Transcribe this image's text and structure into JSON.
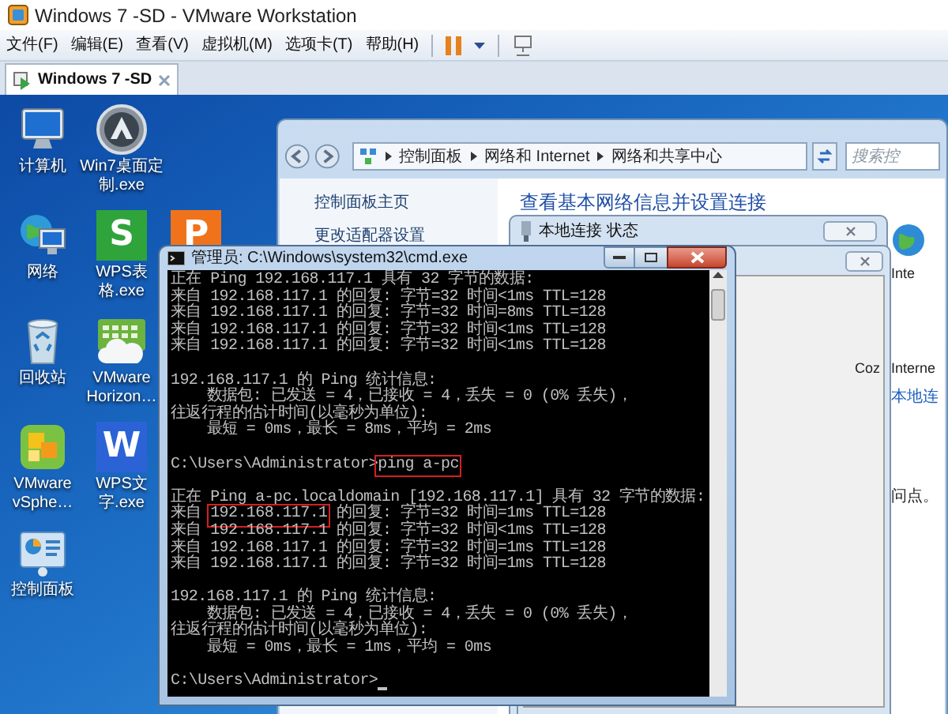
{
  "window": {
    "title": "Windows 7 -SD - VMware Workstation"
  },
  "menu": [
    "文件(F)",
    "编辑(E)",
    "查看(V)",
    "虚拟机(M)",
    "选项卡(T)",
    "帮助(H)"
  ],
  "tabs": [
    {
      "label": "Windows 7 -SD",
      "selected": true
    }
  ],
  "desktop_icons": [
    {
      "kind": "computer",
      "label": "计算机"
    },
    {
      "kind": "network",
      "label": "网络"
    },
    {
      "kind": "recycle-bin",
      "label": "回收站"
    },
    {
      "kind": "vsphere",
      "label": "VMware vSphe…"
    },
    {
      "kind": "control-panel",
      "label": "控制面板"
    },
    {
      "kind": "customizer",
      "label": "Win7桌面定制.exe"
    },
    {
      "kind": "spreadsheet",
      "label": "WPS表格.exe",
      "glyph": "S"
    },
    {
      "kind": "horizon",
      "label": "VMware Horizon…"
    },
    {
      "kind": "writer",
      "label": "WPS文字.exe",
      "glyph": "W"
    }
  ],
  "partial_icon": {
    "kind": "presentation",
    "glyph": "P"
  },
  "explorer": {
    "breadcrumb": [
      "控制面板",
      "网络和 Internet",
      "网络和共享中心"
    ],
    "search": {
      "placeholder": "搜索控"
    },
    "sidebar": [
      "控制面板主页",
      "更改适配器设置"
    ],
    "heading": "查看基本网络信息并设置连接",
    "right_texts": [
      {
        "kind": "label",
        "text": "Inte"
      },
      {
        "kind": "label",
        "text": "Interne"
      },
      {
        "kind": "link",
        "text": "本地连"
      },
      {
        "kind": "label",
        "text": "问点。"
      }
    ]
  },
  "dialogs": [
    {
      "title": "本地连接 状态"
    },
    {
      "text": "Coz"
    }
  ],
  "cmd": {
    "title": "管理员: C:\\Windows\\system32\\cmd.exe",
    "lines": [
      {
        "kind": "text",
        "text": "正在 Ping 192.168.117.1 具有 32 字节的数据:"
      },
      {
        "kind": "text",
        "text": "来自 192.168.117.1 的回复: 字节=32 时间<1ms TTL=128"
      },
      {
        "kind": "text",
        "text": "来自 192.168.117.1 的回复: 字节=32 时间=8ms TTL=128"
      },
      {
        "kind": "text",
        "text": "来自 192.168.117.1 的回复: 字节=32 时间<1ms TTL=128"
      },
      {
        "kind": "text",
        "text": "来自 192.168.117.1 的回复: 字节=32 时间<1ms TTL=128"
      },
      {
        "kind": "blank"
      },
      {
        "kind": "text",
        "text": "192.168.117.1 的 Ping 统计信息:"
      },
      {
        "kind": "text",
        "text": "    数据包: 已发送 = 4，已接收 = 4，丢失 = 0 (0% 丢失)，"
      },
      {
        "kind": "text",
        "text": "往返行程的估计时间(以毫秒为单位):"
      },
      {
        "kind": "text",
        "text": "    最短 = 0ms，最长 = 8ms，平均 = 2ms"
      },
      {
        "kind": "blank"
      },
      {
        "kind": "marked",
        "before": "C:\\Users\\Administrator>",
        "marked": "ping a-pc"
      },
      {
        "kind": "blank"
      },
      {
        "kind": "text",
        "text": "正在 Ping a-pc.localdomain [192.168.117.1] 具有 32 字节的数据:"
      },
      {
        "kind": "marked",
        "before": "来自 ",
        "marked": "192.168.117.1",
        "after": " 的回复: 字节=32 时间=1ms TTL=128"
      },
      {
        "kind": "text",
        "text": "来自 192.168.117.1 的回复: 字节=32 时间<1ms TTL=128"
      },
      {
        "kind": "text",
        "text": "来自 192.168.117.1 的回复: 字节=32 时间=1ms TTL=128"
      },
      {
        "kind": "text",
        "text": "来自 192.168.117.1 的回复: 字节=32 时间=1ms TTL=128"
      },
      {
        "kind": "blank"
      },
      {
        "kind": "text",
        "text": "192.168.117.1 的 Ping 统计信息:"
      },
      {
        "kind": "text",
        "text": "    数据包: 已发送 = 4，已接收 = 4，丢失 = 0 (0% 丢失)，"
      },
      {
        "kind": "text",
        "text": "往返行程的估计时间(以毫秒为单位):"
      },
      {
        "kind": "text",
        "text": "    最短 = 0ms，最长 = 1ms，平均 = 0ms"
      },
      {
        "kind": "blank"
      },
      {
        "kind": "prompt",
        "text": "C:\\Users\\Administrator>",
        "cursor": true
      }
    ]
  }
}
